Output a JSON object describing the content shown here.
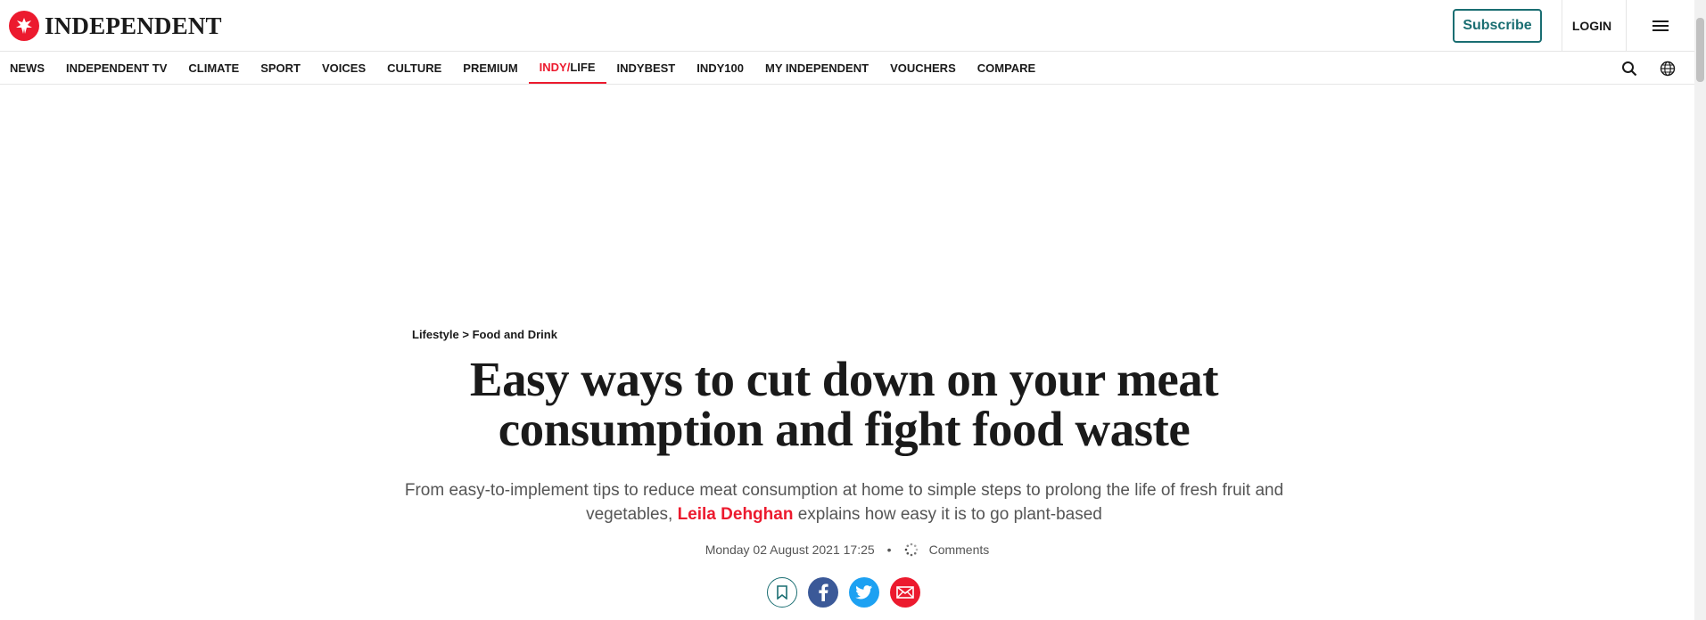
{
  "brand": {
    "name": "INDEPENDENT",
    "accent": "#ec1a2e",
    "teal": "#1a6e72"
  },
  "header": {
    "subscribe_label": "Subscribe",
    "login_label": "LOGIN"
  },
  "nav": {
    "items": [
      "NEWS",
      "INDEPENDENT TV",
      "CLIMATE",
      "SPORT",
      "VOICES",
      "CULTURE",
      "PREMIUM"
    ],
    "active": {
      "part1": "INDY/",
      "part2": "LIFE"
    },
    "items_after": [
      "INDYBEST",
      "INDY100",
      "MY INDEPENDENT",
      "VOUCHERS",
      "COMPARE"
    ]
  },
  "article": {
    "breadcrumb": {
      "section": "Lifestyle",
      "separator": ">",
      "subsection": "Food and Drink"
    },
    "headline": "Easy ways to cut down on your meat consumption and fight food waste",
    "standfirst_before": "From easy-to-implement tips to reduce meat consumption at home to simple steps to prolong the life of fresh fruit and vegetables, ",
    "author": "Leila Dehghan",
    "standfirst_after": " explains how easy it is to go plant-based",
    "date": "Monday 02 August 2021 17:25",
    "bullet": "•",
    "comments_label": "Comments"
  },
  "share_icons": [
    "bookmark-icon",
    "facebook-icon",
    "twitter-icon",
    "email-icon"
  ]
}
